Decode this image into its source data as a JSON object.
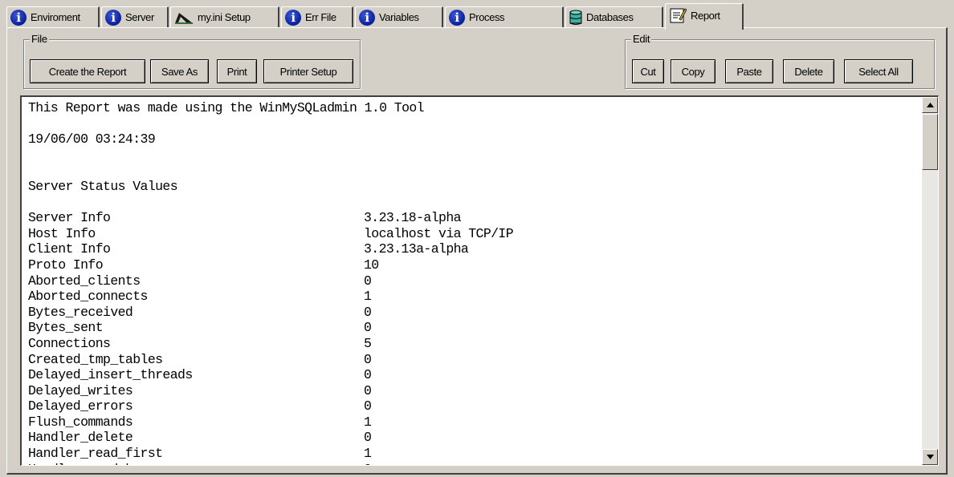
{
  "tabs": [
    {
      "label": "Enviroment",
      "icon": "info-icon"
    },
    {
      "label": "Server",
      "icon": "info-icon"
    },
    {
      "label": "my.ini Setup",
      "icon": "ruler-icon"
    },
    {
      "label": "Err File",
      "icon": "info-icon"
    },
    {
      "label": "Variables",
      "icon": "info-icon"
    },
    {
      "label": "Process",
      "icon": "info-icon"
    },
    {
      "label": "Databases",
      "icon": "database-icon"
    },
    {
      "label": "Report",
      "icon": "report-icon",
      "active": true
    }
  ],
  "file_group": {
    "title": "File",
    "buttons": [
      "Create the Report",
      "Save As",
      "Print",
      "Printer Setup"
    ]
  },
  "edit_group": {
    "title": "Edit",
    "buttons": [
      "Cut",
      "Copy",
      "Paste",
      "Delete",
      "Select All"
    ]
  },
  "report": {
    "header": "This Report was made using the WinMySQLadmin 1.0 Tool",
    "timestamp": "19/06/00 03:24:39",
    "section_title": "Server Status Values",
    "rows": [
      {
        "key": "Server Info",
        "value": "3.23.18-alpha"
      },
      {
        "key": "Host Info",
        "value": "localhost via TCP/IP"
      },
      {
        "key": "Client Info",
        "value": "3.23.13a-alpha"
      },
      {
        "key": "Proto Info",
        "value": "10"
      },
      {
        "key": "Aborted_clients",
        "value": "0"
      },
      {
        "key": "Aborted_connects",
        "value": "1"
      },
      {
        "key": "Bytes_received",
        "value": "0"
      },
      {
        "key": "Bytes_sent",
        "value": "0"
      },
      {
        "key": "Connections",
        "value": "5"
      },
      {
        "key": "Created_tmp_tables",
        "value": "0"
      },
      {
        "key": "Delayed_insert_threads",
        "value": "0"
      },
      {
        "key": "Delayed_writes",
        "value": "0"
      },
      {
        "key": "Delayed_errors",
        "value": "0"
      },
      {
        "key": "Flush_commands",
        "value": "1"
      },
      {
        "key": "Handler_delete",
        "value": "0"
      },
      {
        "key": "Handler_read_first",
        "value": "1"
      }
    ]
  },
  "colors": {
    "window_bg": "#d4d0c8",
    "info_icon": "#0a1e9a",
    "memo_bg": "#ffffff"
  }
}
